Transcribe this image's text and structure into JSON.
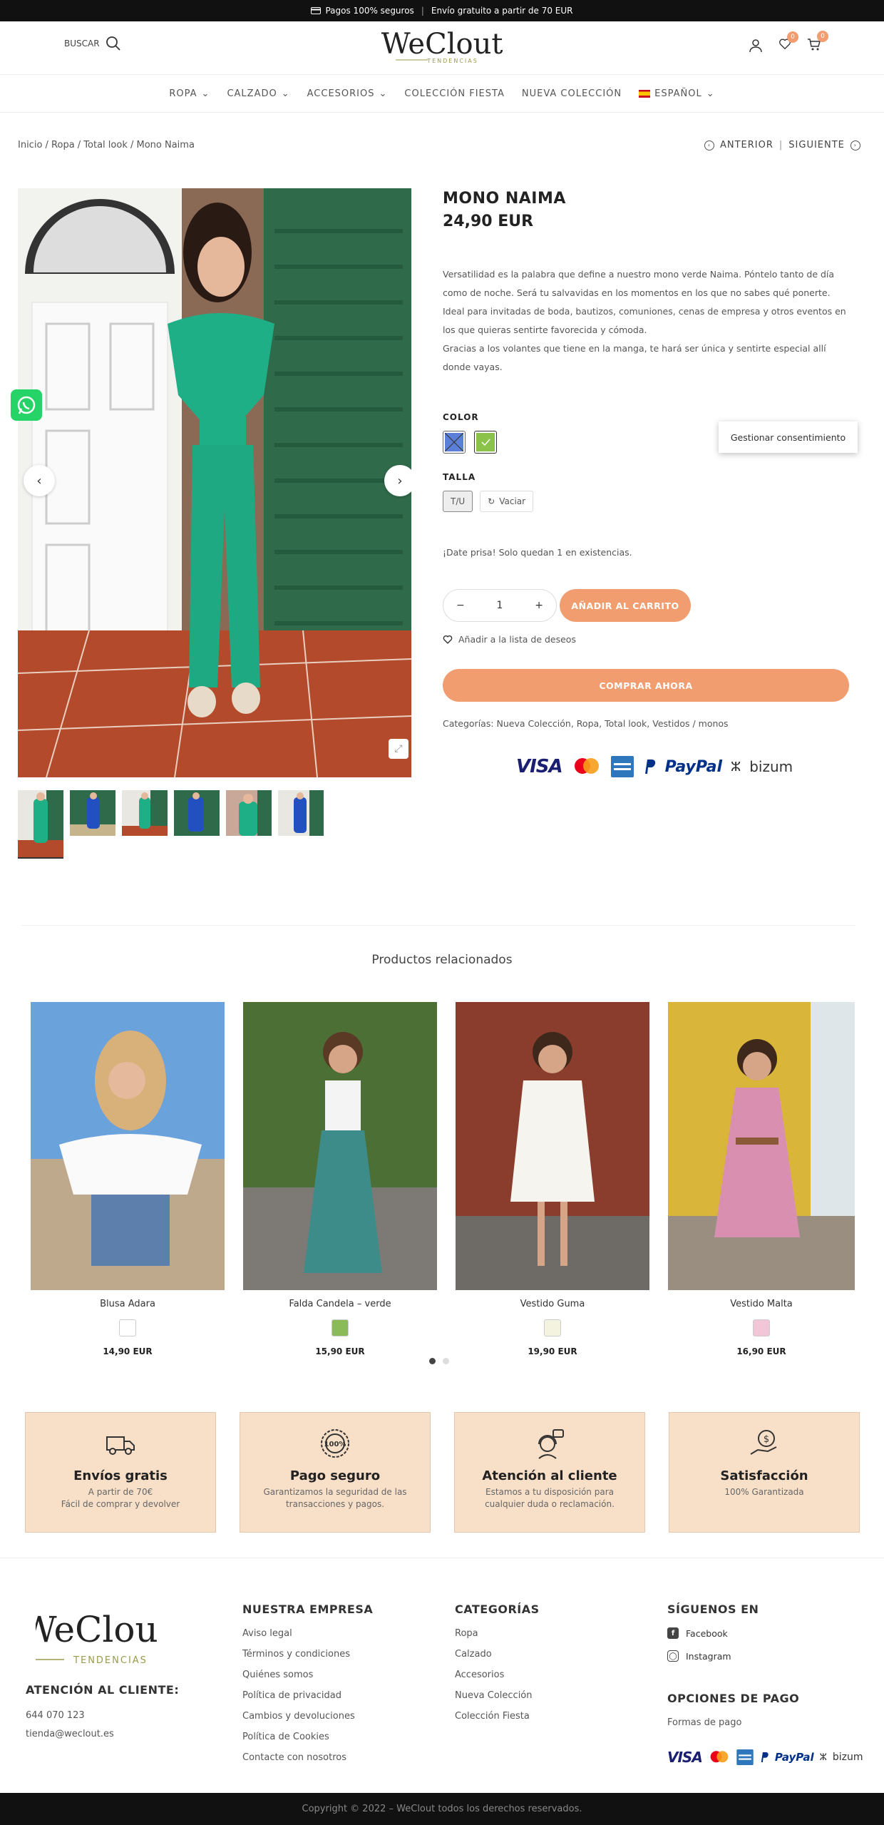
{
  "topbar": {
    "secure": "Pagos 100% seguros",
    "sep": "|",
    "shipping": "Envío gratuito a partir de 70 EUR"
  },
  "header": {
    "search_label": "BUSCAR",
    "logo_main": "WeClout",
    "logo_sub": "TENDENCIAS",
    "wishlist_count": "0",
    "cart_count": "0"
  },
  "nav": {
    "items": [
      "ROPA",
      "CALZADO",
      "ACCESORIOS",
      "COLECCIÓN FIESTA",
      "NUEVA COLECCIÓN"
    ],
    "lang": "ESPAÑOL"
  },
  "breadcrumb": {
    "text": "Inicio / Ropa / Total look / Mono Naima"
  },
  "pager": {
    "prev": "ANTERIOR",
    "sep": "|",
    "next": "SIGUIENTE"
  },
  "product": {
    "title": "MONO NAIMA",
    "price": "24,90 EUR",
    "description": "Versatilidad es la palabra que define a nuestro mono verde Naima. Póntelo tanto de día como de noche. Será tu salvavidas en los momentos en los que no sabes qué ponerte. Ideal para invitadas de boda, bautizos, comuniones, cenas de empresa y otros eventos en los que quieras sentirte favorecida y cómoda.",
    "description2": "Gracias a los volantes que tiene en la manga, te hará ser única y sentirte especial allí donde vayas.",
    "color_label": "COLOR",
    "size_label": "TALLA",
    "size_value": "T/U",
    "clear_label": "Vaciar",
    "stock": "¡Date prisa! Solo quedan 1 en existencias.",
    "qty": "1",
    "add_to_cart": "AÑADIR AL CARRITO",
    "wishlist": "Añadir a la lista de deseos",
    "buy_now": "COMPRAR AHORA",
    "categories": "Categorías: Nueva Colección, Ropa, Total look, Vestidos / monos",
    "colors": {
      "primary": "#f29d6f",
      "swatch_green": "#8bc34a",
      "swatch_blue": "#5b7fd6"
    }
  },
  "consent": {
    "label": "Gestionar consentimiento"
  },
  "payments": {
    "visa": "VISA",
    "paypal": "PayPal",
    "bizum": "bizum"
  },
  "related": {
    "heading": "Productos relacionados",
    "items": [
      {
        "name": "Blusa Adara",
        "price": "14,90 EUR"
      },
      {
        "name": "Falda Candela – verde",
        "price": "15,90 EUR"
      },
      {
        "name": "Vestido Guma",
        "price": "19,90 EUR"
      },
      {
        "name": "Vestido Malta",
        "price": "16,90 EUR"
      }
    ]
  },
  "features": [
    {
      "title": "Envíos gratis",
      "line1": "A partir de 70€",
      "line2": "Fácil de comprar y devolver",
      "icon": "truck-icon"
    },
    {
      "title": "Pago seguro",
      "line1": "Garantizamos la seguridad de las",
      "line2": "transacciones y pagos.",
      "icon": "badge-100-icon"
    },
    {
      "title": "Atención al cliente",
      "line1": "Estamos a tu disposición para",
      "line2": "cualquier duda o reclamación.",
      "icon": "support-icon"
    },
    {
      "title": "Satisfacción",
      "line1": "100% Garantizada",
      "line2": "",
      "icon": "money-hand-icon"
    }
  ],
  "footer": {
    "attention": "ATENCIÓN AL CLIENTE:",
    "phone": "644 070 123",
    "email": "tienda@weclout.es",
    "company_head": "NUESTRA EMPRESA",
    "company_links": [
      "Aviso legal",
      "Términos y condiciones",
      "Quiénes somos",
      "Política de privacidad",
      "Cambios y devoluciones",
      "Política de Cookies",
      "Contacte con nosotros"
    ],
    "cat_head": "CATEGORÍAS",
    "cat_links": [
      "Ropa",
      "Calzado",
      "Accesorios",
      "Nueva Colección",
      "Colección Fiesta"
    ],
    "follow_head": "SÍGUENOS EN",
    "facebook": "Facebook",
    "instagram": "Instagram",
    "pay_head": "OPCIONES DE PAGO",
    "pay_link": "Formas de pago",
    "copyright": "Copyright © 2022 – WeClout todos los derechos reservados."
  }
}
